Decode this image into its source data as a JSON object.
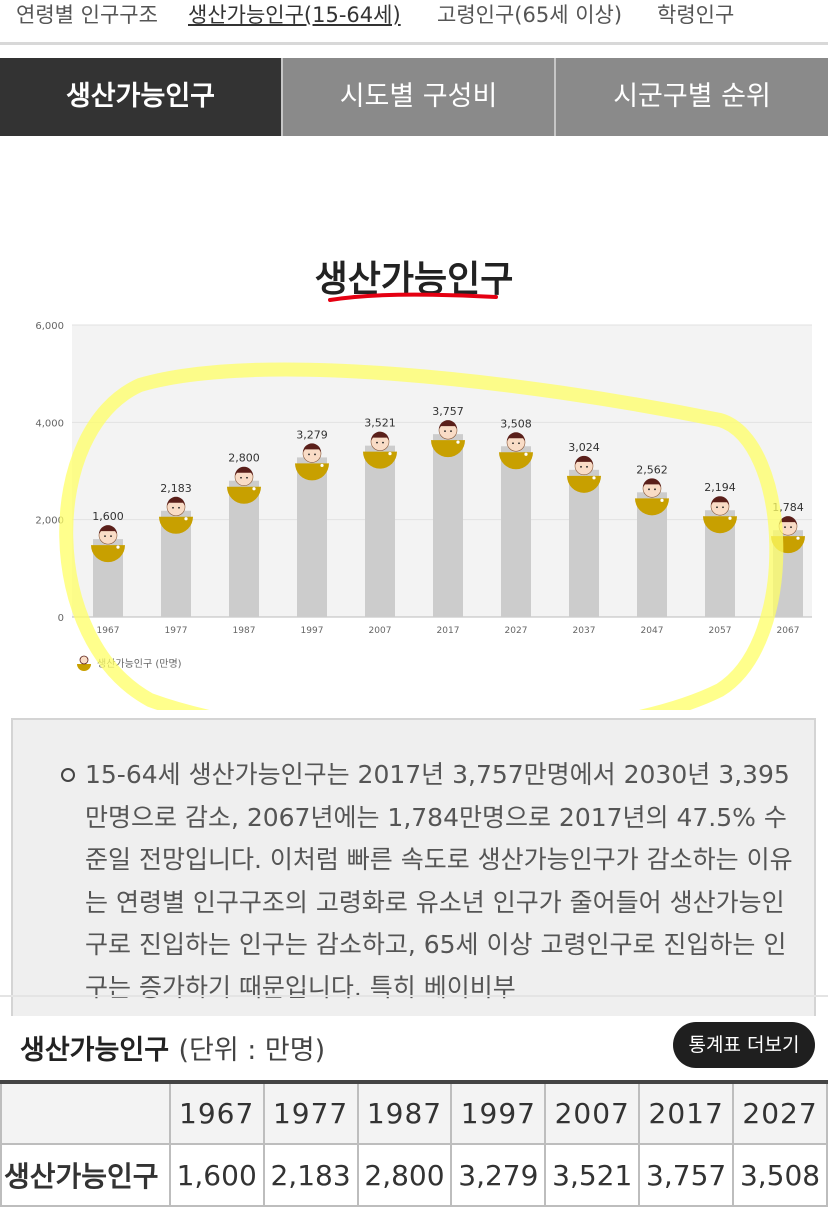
{
  "top_nav": {
    "items": [
      "연령별 인구구조",
      "생산가능인구(15-64세)",
      "고령인구(65세 이상)",
      "학령인구"
    ],
    "active_index": 1
  },
  "tabs": [
    {
      "label": "생산가능인구",
      "active": true
    },
    {
      "label": "시도별 구성비",
      "active": false
    },
    {
      "label": "시군구별 순위",
      "active": false
    }
  ],
  "chart_heading": "생산가능인구",
  "colors": {
    "accent_red": "#e50012",
    "bar_gray": "#cccccc",
    "figure_gold": "#c8a000",
    "highlight_yellow": "#ffff66",
    "tab_active": "#333333",
    "tab_inactive": "#8a8a8a"
  },
  "chart_data": {
    "type": "bar",
    "categories": [
      "1967",
      "1977",
      "1987",
      "1997",
      "2007",
      "2017",
      "2027",
      "2037",
      "2047",
      "2057",
      "2067"
    ],
    "values": [
      1600,
      2183,
      2800,
      3279,
      3521,
      3757,
      3508,
      3024,
      2562,
      2194,
      1784
    ],
    "value_labels": [
      "1,600",
      "2,183",
      "2,800",
      "3,279",
      "3,521",
      "3,757",
      "3,508",
      "3,024",
      "2,562",
      "2,194",
      "1,784"
    ],
    "y_ticks": [
      "0",
      "2,000",
      "4,000",
      "6,000"
    ],
    "ylim": [
      0,
      6000
    ],
    "legend": "생산가능인구 (만명)",
    "legend_position": "bottom-left",
    "grid": true
  },
  "info": {
    "text": "15-64세 생산가능인구는 2017년 3,757만명에서 2030년 3,395만명으로 감소, 2067년에는 1,784만명으로 2017년의 47.5% 수준일 전망입니다. 이처럼 빠른 속도로 생산가능인구가 감소하는 이유는 연령별 인구구조의 고령화로 유소년 인구가 줄어들어 생산가능인구로 진입하는 인구는 감소하고, 65세 이상 고령인구로 진입하는 인구는 증가하기 때문입니다. 특히 베이비부"
  },
  "table": {
    "title": "생산가능인구",
    "unit": "(단위 : 만명)",
    "more_button": "통계표 더보기",
    "row_label": "생산가능인구",
    "years": [
      "1967",
      "1977",
      "1987",
      "1997",
      "2007",
      "2017",
      "2027"
    ],
    "values": [
      "1,600",
      "2,183",
      "2,800",
      "3,279",
      "3,521",
      "3,757",
      "3,508"
    ]
  }
}
